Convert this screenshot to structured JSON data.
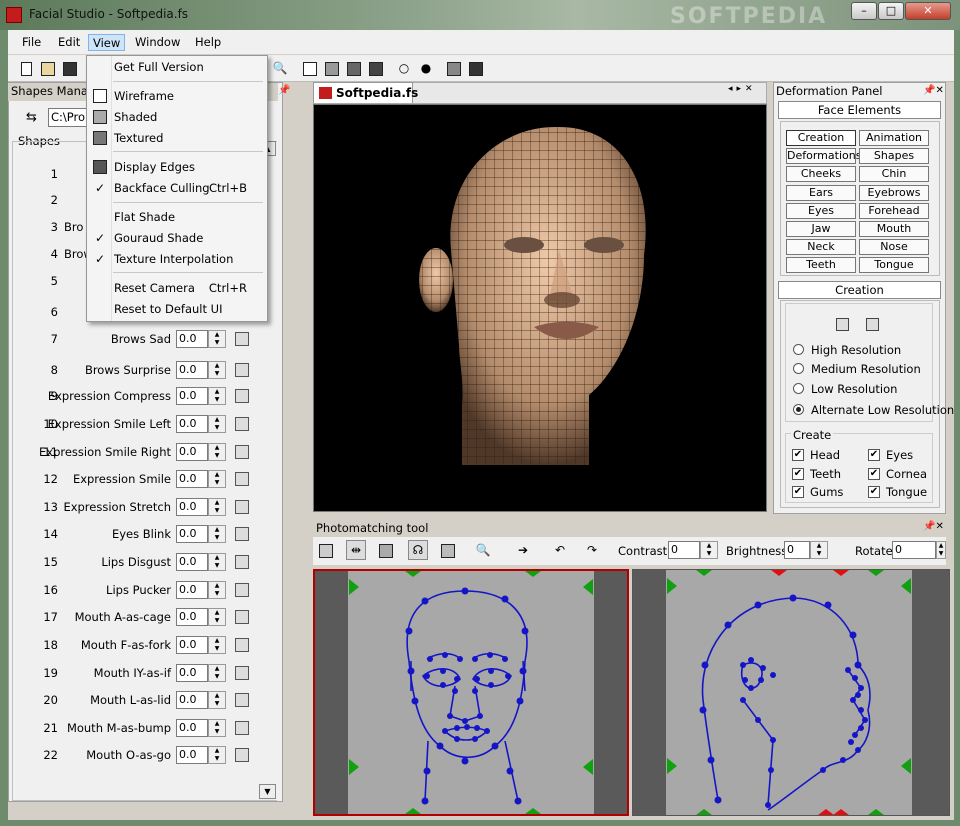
{
  "window": {
    "title": "Facial Studio - Softpedia.fs",
    "watermark": "SOFTPEDIA"
  },
  "menubar": [
    "File",
    "Edit",
    "View",
    "Window",
    "Help"
  ],
  "view_menu": {
    "items": [
      {
        "label": "Get Full Version",
        "shortcut": "",
        "checked": false,
        "icon": ""
      },
      {
        "label": "Wireframe",
        "shortcut": "",
        "checked": false,
        "icon": "wireframe-icon"
      },
      {
        "label": "Shaded",
        "shortcut": "",
        "checked": false,
        "icon": "shaded-icon"
      },
      {
        "label": "Textured",
        "shortcut": "",
        "checked": false,
        "icon": "textured-icon"
      },
      {
        "label": "Display Edges",
        "shortcut": "",
        "checked": false,
        "icon": "display-edges-icon"
      },
      {
        "label": "Backface Culling",
        "shortcut": "Ctrl+B",
        "checked": true,
        "icon": ""
      },
      {
        "label": "Flat Shade",
        "shortcut": "",
        "checked": false,
        "icon": ""
      },
      {
        "label": "Gouraud Shade",
        "shortcut": "",
        "checked": true,
        "icon": ""
      },
      {
        "label": "Texture Interpolation",
        "shortcut": "",
        "checked": true,
        "icon": ""
      },
      {
        "label": "Reset Camera",
        "shortcut": "Ctrl+R",
        "checked": false,
        "icon": ""
      },
      {
        "label": "Reset to Default UI",
        "shortcut": "",
        "checked": false,
        "icon": ""
      }
    ]
  },
  "shapes_manager": {
    "title": "Shapes Manag",
    "path_value": "C:\\Pro",
    "group_label": "Shapes",
    "rows": [
      {
        "num": "1",
        "label": "",
        "value": ""
      },
      {
        "num": "2",
        "label": "",
        "value": ""
      },
      {
        "num": "3",
        "label": "Bro",
        "value": ""
      },
      {
        "num": "4",
        "label": "Brow",
        "value": ""
      },
      {
        "num": "5",
        "label": "",
        "value": ""
      },
      {
        "num": "6",
        "label": "",
        "value": ""
      },
      {
        "num": "7",
        "label": "Brows Sad",
        "value": "0.0"
      },
      {
        "num": "8",
        "label": "Brows Surprise",
        "value": "0.0"
      },
      {
        "num": "9",
        "label": "Expression Compress",
        "value": "0.0"
      },
      {
        "num": "10",
        "label": "Expression Smile Left",
        "value": "0.0"
      },
      {
        "num": "11",
        "label": "Expression Smile Right",
        "value": "0.0"
      },
      {
        "num": "12",
        "label": "Expression Smile",
        "value": "0.0"
      },
      {
        "num": "13",
        "label": "Expression Stretch",
        "value": "0.0"
      },
      {
        "num": "14",
        "label": "Eyes Blink",
        "value": "0.0"
      },
      {
        "num": "15",
        "label": "Lips Disgust",
        "value": "0.0"
      },
      {
        "num": "16",
        "label": "Lips Pucker",
        "value": "0.0"
      },
      {
        "num": "17",
        "label": "Mouth A-as-cage",
        "value": "0.0"
      },
      {
        "num": "18",
        "label": "Mouth F-as-fork",
        "value": "0.0"
      },
      {
        "num": "19",
        "label": "Mouth IY-as-if",
        "value": "0.0"
      },
      {
        "num": "20",
        "label": "Mouth L-as-lid",
        "value": "0.0"
      },
      {
        "num": "21",
        "label": "Mouth M-as-bump",
        "value": "0.0"
      },
      {
        "num": "22",
        "label": "Mouth O-as-go",
        "value": "0.0"
      }
    ]
  },
  "document_tab": "Softpedia.fs",
  "deformation_panel": {
    "title": "Deformation Panel",
    "face_elements_header": "Face Elements",
    "buttons": [
      "Creation",
      "Animation",
      "Deformations",
      "Shapes",
      "Cheeks",
      "Chin",
      "Ears",
      "Eyebrows",
      "Eyes",
      "Forehead",
      "Jaw",
      "Mouth",
      "Neck",
      "Nose",
      "Teeth",
      "Tongue"
    ],
    "creation_header": "Creation",
    "resolutions": [
      {
        "label": "High Resolution",
        "selected": false
      },
      {
        "label": "Medium Resolution",
        "selected": false
      },
      {
        "label": "Low Resolution",
        "selected": false
      },
      {
        "label": "Alternate Low Resolution",
        "selected": true
      }
    ],
    "create_group": "Create",
    "create_items": [
      {
        "label": "Head",
        "checked": true
      },
      {
        "label": "Eyes",
        "checked": true
      },
      {
        "label": "Teeth",
        "checked": true
      },
      {
        "label": "Cornea",
        "checked": true
      },
      {
        "label": "Gums",
        "checked": true
      },
      {
        "label": "Tongue",
        "checked": true
      }
    ]
  },
  "photomatching": {
    "title": "Photomatching tool",
    "contrast_label": "Contrast",
    "contrast_value": "0",
    "brightness_label": "Brightness",
    "brightness_value": "0",
    "rotate_label": "Rotate",
    "rotate_value": "0"
  },
  "colors": {
    "accent_red": "#c21c1c",
    "curve_blue": "#1515c8",
    "marker_green": "#10a010",
    "marker_red": "#e01010"
  }
}
